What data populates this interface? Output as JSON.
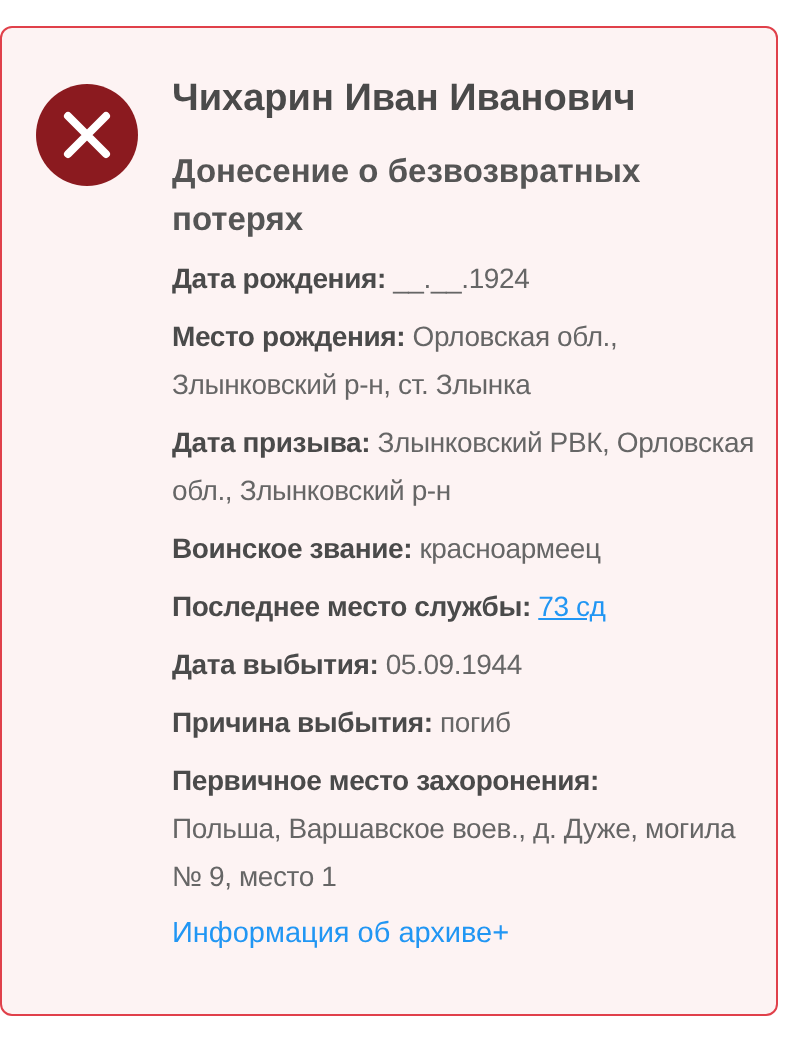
{
  "record": {
    "deceased": true,
    "name": "Чихарин Иван Иванович",
    "document": "Донесение о безвозвратных потерях",
    "fields": [
      {
        "label": "Дата рождения:",
        "value": "__.__.1924",
        "kind": "text"
      },
      {
        "label": "Место рождения:",
        "value": "Орловская обл., Злынковский р-н, ст. Злынка",
        "kind": "text"
      },
      {
        "label": "Дата призыва:",
        "value": "Злынковский РВК, Орловская обл., Злынковский р-н",
        "kind": "text"
      },
      {
        "label": "Воинское звание:",
        "value": "красноармеец",
        "kind": "text"
      },
      {
        "label": "Последнее место службы:",
        "value": "73 сд",
        "kind": "link"
      },
      {
        "label": "Дата выбытия:",
        "value": "05.09.1944",
        "kind": "text"
      },
      {
        "label": "Причина выбытия:",
        "value": "погиб",
        "kind": "text"
      },
      {
        "label": "Первичное место захоронения:",
        "value": "Польша, Варшавское воев., д. Дуже, могила № 9, место 1",
        "kind": "block"
      }
    ],
    "archive_link": "Информация об архиве+"
  }
}
